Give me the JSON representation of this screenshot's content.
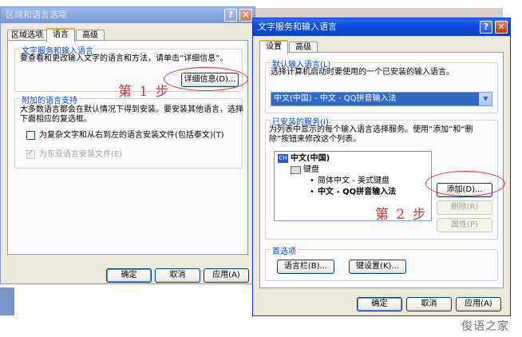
{
  "win1": {
    "title": "区域和语言选项",
    "tabs": [
      "区域选项",
      "语言",
      "高级"
    ],
    "group1": {
      "title": "文字服务和输入语言",
      "desc": "要查看和更改输入文字的语言和方法，请单击“详细信息”。",
      "details_button": "详细信息(D)..."
    },
    "group2": {
      "title": "附加的语言支持",
      "desc_line1": "大多数语言都会在默认情况下得到安装。要安装其他语言，选择",
      "desc_line2": "下面相应的复选框。",
      "check1": "为复杂文字和从右到左的语言安装文件(包括泰文)(T)",
      "check2": "为东亚语言安装文件(E)"
    },
    "buttons": {
      "ok": "确定",
      "cancel": "取消",
      "apply": "应用(A)"
    }
  },
  "win2": {
    "title": "文字服务和输入语言",
    "tabs": [
      "设置",
      "高级"
    ],
    "default_group": {
      "title": "默认输入语言(L)",
      "desc": "选择计算机启动时要使用的一个已安装的输入语言。",
      "selected": "中文(中国) - 中文 - QQ拼音输入法"
    },
    "services_group": {
      "title": "已安装的服务(I)",
      "desc_line1": "为列表中显示的每个输入语言选择服务。使用“添加”和“删",
      "desc_line2": "除”按钮来修改这个列表。",
      "tree": {
        "lang_badge": "CH",
        "lang": "中文(中国)",
        "keyboard": "键盘",
        "items": [
          "简体中文 - 美式键盘",
          "中文 - QQ拼音输入法"
        ]
      },
      "add_button": "添加(D)...",
      "remove_button": "删除(R)",
      "props_button": "属性(P)"
    },
    "prefs_group": {
      "title": "首选项",
      "langbar_button": "语言栏(B)...",
      "keyset_button": "键设置(K)..."
    },
    "buttons": {
      "ok": "确定",
      "cancel": "取消",
      "apply": "应用(A)"
    }
  },
  "annotations": {
    "step1": "第 1 步",
    "step2": "第 2 步"
  },
  "watermark": "俊语之家",
  "colors": {
    "annotation": "#e0313b",
    "group_title": "#0046d5",
    "titlebar_active": "#0a4bd6"
  }
}
